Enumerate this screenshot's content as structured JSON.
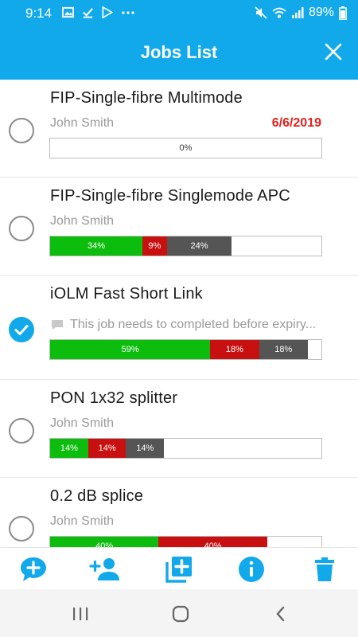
{
  "status_bar": {
    "time": "9:14",
    "battery": "89%"
  },
  "header": {
    "title": "Jobs List"
  },
  "jobs": [
    {
      "title": "FIP-Single-fibre Multimode",
      "owner": "John Smith",
      "date": "6/6/2019",
      "checked": false,
      "progress_label": "0%",
      "segments": []
    },
    {
      "title": "FIP-Single-fibre Singlemode APC",
      "owner": "John Smith",
      "checked": false,
      "segments": [
        {
          "status": "pass",
          "label": "34%",
          "value": 34
        },
        {
          "status": "fail",
          "label": "9%",
          "value": 9
        },
        {
          "status": "other",
          "label": "24%",
          "value": 24
        }
      ]
    },
    {
      "title": "iOLM Fast Short Link",
      "note": "This job needs to completed before expiry...",
      "checked": true,
      "segments": [
        {
          "status": "pass",
          "label": "59%",
          "value": 59
        },
        {
          "status": "fail",
          "label": "18%",
          "value": 18
        },
        {
          "status": "other",
          "label": "18%",
          "value": 18
        }
      ]
    },
    {
      "title": "PON 1x32 splitter",
      "owner": "John Smith",
      "checked": false,
      "segments": [
        {
          "status": "pass",
          "label": "14%",
          "value": 14
        },
        {
          "status": "fail",
          "label": "14%",
          "value": 14
        },
        {
          "status": "other",
          "label": "14%",
          "value": 14
        }
      ]
    },
    {
      "title": "0.2 dB splice",
      "owner": "John Smith",
      "checked": false,
      "segments": [
        {
          "status": "pass",
          "label": "40%",
          "value": 40
        },
        {
          "status": "fail",
          "label": "40%",
          "value": 40
        }
      ]
    }
  ],
  "toolbar": {
    "icons": [
      "add-comment-icon",
      "add-user-icon",
      "add-copy-icon",
      "info-icon",
      "trash-icon"
    ]
  },
  "colors": {
    "accent": "#12a9ea",
    "pass": "#0dbd0d",
    "fail": "#c91010",
    "other": "#555555",
    "date": "#e3211c"
  }
}
